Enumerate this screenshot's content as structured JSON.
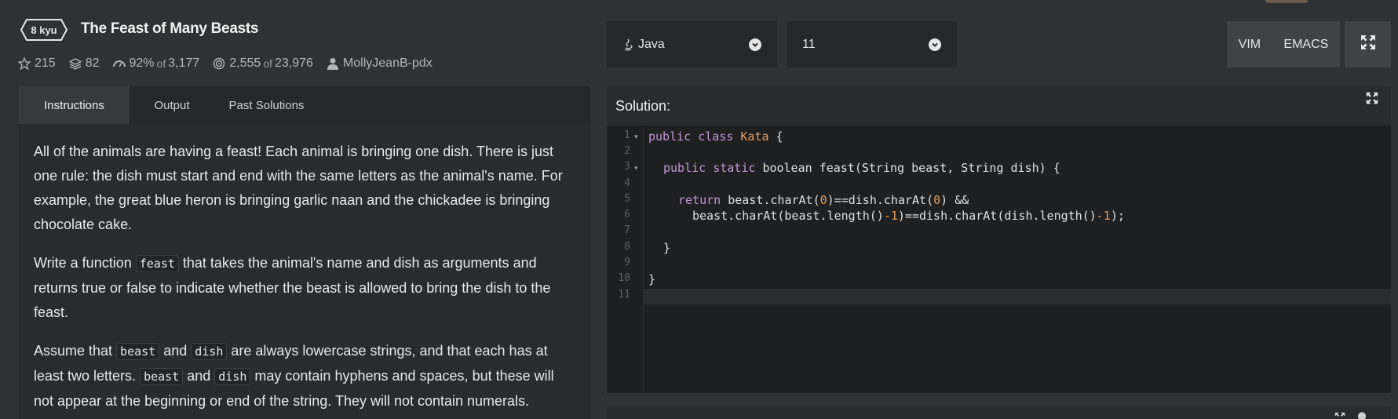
{
  "kata": {
    "rank": "8 kyu",
    "title": "The Feast of Many Beasts"
  },
  "stats": {
    "stars": "215",
    "collections": "82",
    "satisfaction": "92%",
    "satisfaction_of": "of",
    "satisfaction_votes": "3,177",
    "completed": "2,555",
    "completed_of": "of",
    "attempts": "23,976",
    "author": "MollyJeanB-pdx"
  },
  "language": {
    "selected": "Java",
    "version": "11"
  },
  "editor_modes": [
    "VIM",
    "EMACS"
  ],
  "tabs": [
    "Instructions",
    "Output",
    "Past Solutions"
  ],
  "instructions": {
    "p1": "All of the animals are having a feast! Each animal is bringing one dish. There is just one rule: the dish must start and end with the same letters as the animal's name. For example, the great blue heron is bringing garlic naan and the chickadee is bringing chocolate cake.",
    "p2_a": "Write a function ",
    "p2_code": "feast",
    "p2_b": " that takes the animal's name and dish as arguments and returns true or false to indicate whether the beast is allowed to bring the dish to the feast.",
    "p3_a": "Assume that ",
    "p3_code1": "beast",
    "p3_b": " and ",
    "p3_code2": "dish",
    "p3_c": " are always lowercase strings, and that each has at least two letters. ",
    "p3_code3": "beast",
    "p3_d": " and ",
    "p3_code4": "dish",
    "p3_e": " may contain hyphens and spaces, but these will not appear at the beginning or end of the string. They will not contain numerals."
  },
  "solution": {
    "label": "Solution:",
    "line_numbers": [
      "1",
      "2",
      "3",
      "4",
      "5",
      "6",
      "7",
      "8",
      "9",
      "10",
      "11"
    ],
    "code": {
      "l1_kw": "public class ",
      "l1_cls": "Kata",
      "l1_rest": " {",
      "l3_kw": "public static ",
      "l3_type": "boolean ",
      "l3_rest": "feast(String beast, String dish) {",
      "l5_kw": "return ",
      "l5_a": "beast.charAt(",
      "l5_n1": "0",
      "l5_b": ")==dish.charAt(",
      "l5_n2": "0",
      "l5_c": ") &&",
      "l6_a": "beast.charAt(beast.length()",
      "l6_n1": "-1",
      "l6_b": ")==dish.charAt(dish.length()",
      "l6_n2": "-1",
      "l6_c": ");",
      "l8": "}",
      "l10": "}"
    }
  },
  "colors": {
    "background": "#303132",
    "panel": "#2a2b2d",
    "editor": "#1e1f20",
    "keyword": "#c397d8",
    "number": "#e89a5c"
  },
  "icons": [
    "star-icon",
    "collections-icon",
    "satisfaction-icon",
    "completed-icon",
    "user-icon",
    "java-icon",
    "chevron-down-icon",
    "fullscreen-icon",
    "expand-icon"
  ]
}
